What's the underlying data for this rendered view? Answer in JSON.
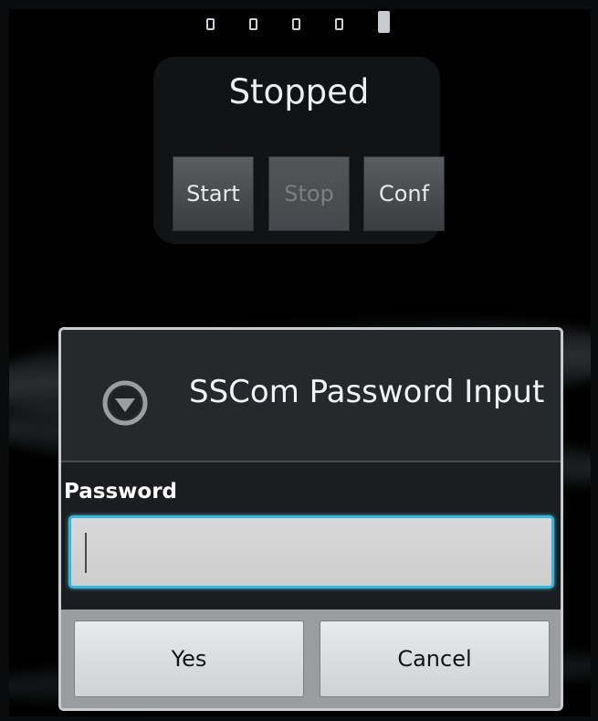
{
  "home": {
    "page_indicator": {
      "count": 5,
      "active_index": 4
    },
    "widget": {
      "status": "Stopped",
      "buttons": {
        "start": "Start",
        "stop": "Stop",
        "conf": "Conf"
      }
    }
  },
  "dialog": {
    "icon": "chevron-down-circle-icon",
    "title": "SSCom Password Input",
    "field_label": "Password",
    "field_value": "",
    "buttons": {
      "yes": "Yes",
      "cancel": "Cancel"
    }
  },
  "colors": {
    "focus": "#37b8d8",
    "dialog_bg": "#1b1d20"
  }
}
